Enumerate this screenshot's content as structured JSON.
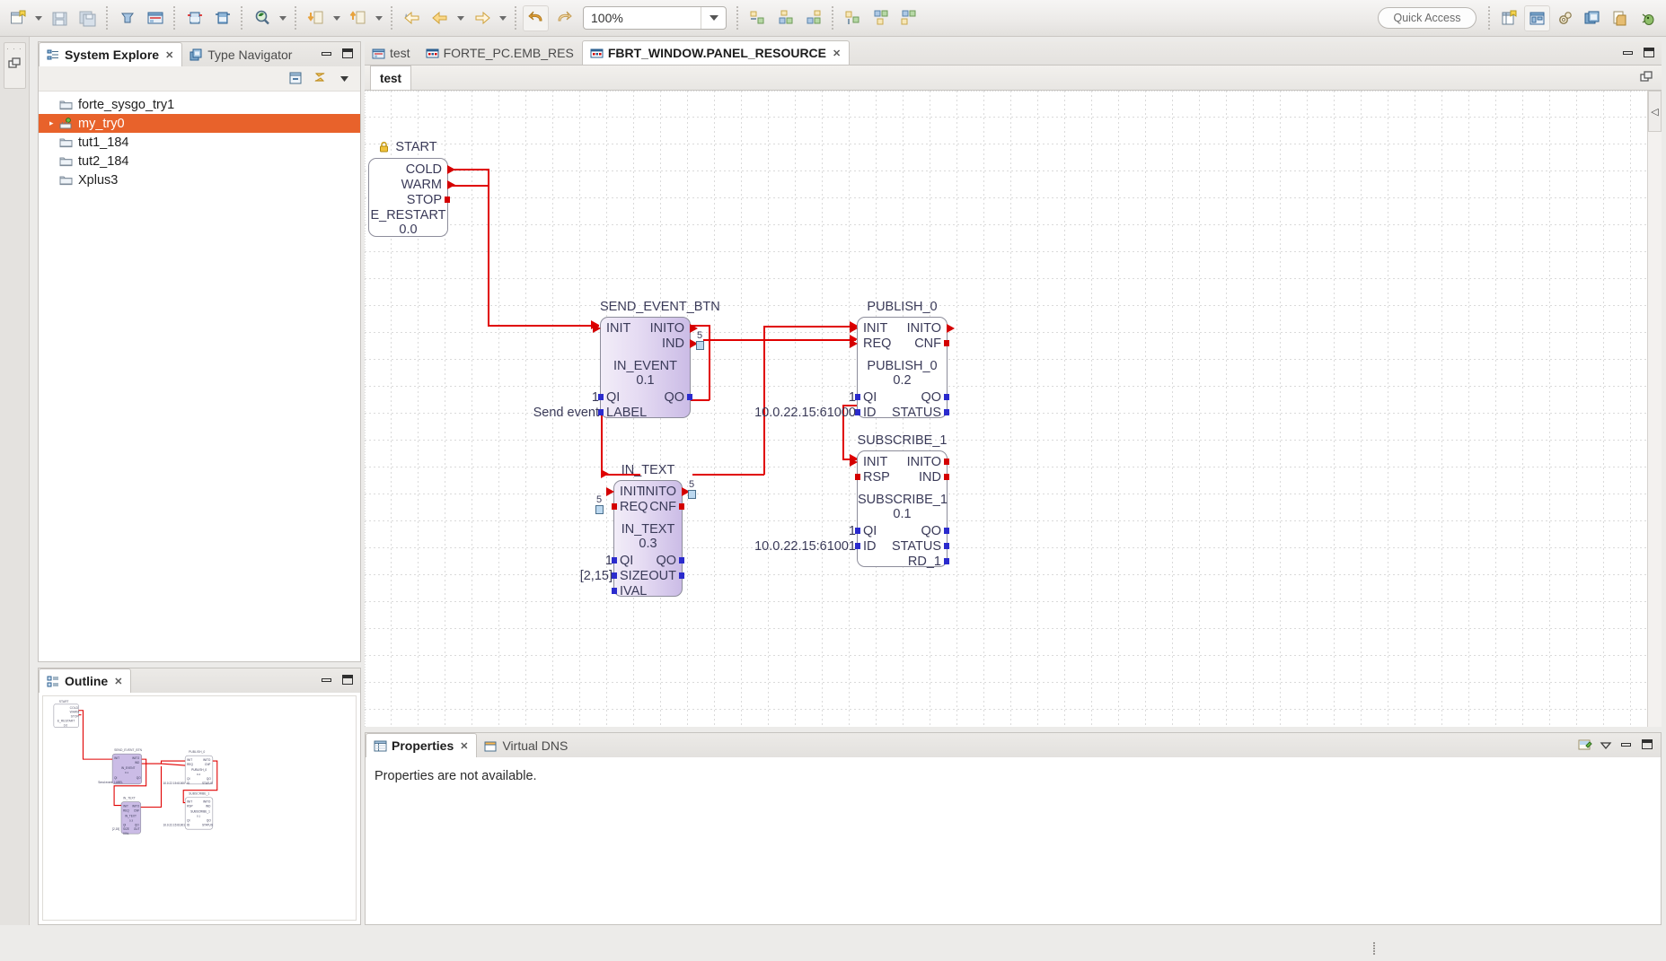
{
  "toolbar": {
    "zoom_value": "100%",
    "quick_access_placeholder": "Quick Access",
    "icons": [
      "new-file-icon",
      "new-file-dropdown-icon",
      "save-icon",
      "save-all-icon",
      "deploy-icon",
      "system-config-icon",
      "fb-type-icon",
      "fb-instance-icon",
      "search-icon",
      "search-dropdown-icon",
      "import-icon",
      "import-dropdown-icon",
      "export-icon",
      "export-dropdown-icon",
      "back-history-icon",
      "back-icon",
      "back-dropdown-icon",
      "forward-icon",
      "forward-dropdown-icon",
      "undo-icon",
      "redo-icon",
      "align-left-icon",
      "align-center-icon",
      "align-right-icon",
      "align-top-icon",
      "align-middle-icon",
      "align-bottom-icon"
    ],
    "right_icons": [
      "new-perspective-icon",
      "system-perspective-icon",
      "gear-perspective-icon",
      "type-perspective-icon",
      "copy-perspective-icon",
      "debug-perspective-icon"
    ]
  },
  "left_strip": {
    "restore_icon": "restore-view-icon"
  },
  "system_explorer": {
    "tabs": [
      {
        "label": "System Explore",
        "icon": "system-explorer-icon",
        "selected": true,
        "closable": true
      },
      {
        "label": "Type Navigator",
        "icon": "type-navigator-icon",
        "selected": false,
        "closable": false
      }
    ],
    "toolbar_icons": [
      "collapse-all-icon",
      "link-editor-icon",
      "view-menu-icon"
    ],
    "panel_buttons": [
      "minimize-icon",
      "maximize-icon"
    ],
    "tree": [
      {
        "label": "forte_sysgo_try1",
        "icon": "folder-icon",
        "selected": false,
        "expandable": false
      },
      {
        "label": "my_try0",
        "icon": "system-icon",
        "selected": true,
        "expandable": true
      },
      {
        "label": "tut1_184",
        "icon": "folder-icon",
        "selected": false,
        "expandable": false
      },
      {
        "label": "tut2_184",
        "icon": "folder-icon",
        "selected": false,
        "expandable": false
      },
      {
        "label": "Xplus3",
        "icon": "folder-icon",
        "selected": false,
        "expandable": false
      }
    ]
  },
  "outline": {
    "tab_label": "Outline",
    "tab_icon": "outline-icon",
    "closable": true,
    "panel_buttons": [
      "minimize-icon",
      "maximize-icon"
    ]
  },
  "editor": {
    "tabs": [
      {
        "label": "test",
        "icon": "system-icon",
        "selected": false,
        "closable": false
      },
      {
        "label": "FORTE_PC.EMB_RES",
        "icon": "resource-icon",
        "selected": false,
        "closable": false
      },
      {
        "label": "FBRT_WINDOW.PANEL_RESOURCE",
        "icon": "resource-icon",
        "selected": true,
        "closable": true
      }
    ],
    "sub_tab": "test",
    "sub_button_icon": "restore-view-icon",
    "panel_buttons": [
      "minimize-icon",
      "maximize-icon"
    ],
    "collapse_icon": "collapse-left-icon"
  },
  "diagram": {
    "blocks": [
      {
        "id": "start",
        "name": "START",
        "locked": true,
        "lock_icon": "lock-icon",
        "type": "E_RESTART",
        "version": "0.0",
        "event_inputs": [],
        "event_outputs": [
          "COLD",
          "WARM",
          "STOP"
        ],
        "data_inputs": [],
        "data_outputs": [],
        "input_values": [],
        "style": "plain"
      },
      {
        "id": "send_event_btn",
        "name": "SEND_EVENT_BTN",
        "type": "IN_EVENT",
        "version": "0.1",
        "event_inputs": [
          "INIT"
        ],
        "event_outputs": [
          "INITO",
          "IND"
        ],
        "data_inputs": [
          "QI",
          "LABEL"
        ],
        "data_outputs": [
          "QO"
        ],
        "input_values": [
          "1",
          "Send event"
        ],
        "style": "purple"
      },
      {
        "id": "publish_0",
        "name": "PUBLISH_0",
        "type": "PUBLISH_0",
        "version": "0.2",
        "event_inputs": [
          "INIT",
          "REQ"
        ],
        "event_outputs": [
          "INITO",
          "CNF"
        ],
        "data_inputs": [
          "QI",
          "ID"
        ],
        "data_outputs": [
          "QO",
          "STATUS"
        ],
        "input_values": [
          "1",
          "10.0.22.15:61000"
        ],
        "style": "plain"
      },
      {
        "id": "in_text",
        "name": "IN_TEXT",
        "type": "IN_TEXT",
        "version": "0.3",
        "event_inputs": [
          "INIT",
          "REQ"
        ],
        "event_outputs": [
          "INITO",
          "CNF"
        ],
        "data_inputs": [
          "QI",
          "SIZE",
          "IVAL"
        ],
        "data_outputs": [
          "QO",
          "OUT"
        ],
        "input_values": [
          "1",
          "[2,15]",
          ""
        ],
        "style": "purple"
      },
      {
        "id": "subscribe_1",
        "name": "SUBSCRIBE_1",
        "type": "SUBSCRIBE_1",
        "version": "0.1",
        "event_inputs": [
          "INIT",
          "RSP"
        ],
        "event_outputs": [
          "INITO",
          "IND"
        ],
        "data_inputs": [
          "QI",
          "ID"
        ],
        "data_outputs": [
          "QO",
          "STATUS",
          "RD_1"
        ],
        "input_values": [
          "1",
          "10.0.22.15:61001"
        ],
        "style": "plain"
      }
    ],
    "adapters": [
      {
        "id": "adapter-send-ind",
        "label": "5"
      },
      {
        "id": "adapter-in-text-req",
        "label": "5"
      },
      {
        "id": "adapter-in-text-inito",
        "label": "5"
      }
    ],
    "connection_color": "#e00000"
  },
  "properties": {
    "tabs": [
      {
        "label": "Properties",
        "icon": "properties-icon",
        "selected": true,
        "closable": true
      },
      {
        "label": "Virtual DNS",
        "icon": "virtual-dns-icon",
        "selected": false,
        "closable": false
      }
    ],
    "message": "Properties are not available.",
    "panel_buttons": [
      "pin-view-icon",
      "view-menu-icon",
      "minimize-icon",
      "maximize-icon"
    ]
  },
  "colors": {
    "selection": "#e8622b",
    "wire": "#e00000",
    "event_port": "#d40000",
    "data_port": "#2b2bcd",
    "fb_fill": "#cbbce6",
    "chrome": "#ecebe9"
  }
}
